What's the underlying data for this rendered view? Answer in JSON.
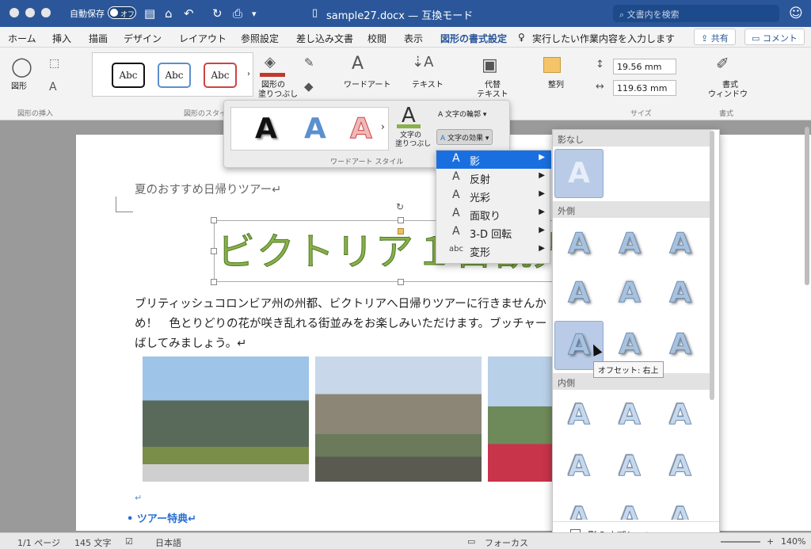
{
  "window": {
    "title": "sample27.docx — 互換モード",
    "autosave_label": "自動保存",
    "autosave_state": "オフ",
    "search_placeholder": "文書内を検索"
  },
  "tabs": [
    "ホーム",
    "挿入",
    "描画",
    "デザイン",
    "レイアウト",
    "参照設定",
    "差し込み文書",
    "校閲",
    "表示",
    "図形の書式設定"
  ],
  "tell_me": "実行したい作業内容を入力します",
  "share_label": "共有",
  "comment_label": "コメント",
  "ribbon": {
    "shapes_label": "図形",
    "group_insert": "図形の挿入",
    "group_styles": "図形のスタイ",
    "shape_style_samples": [
      "Abc",
      "Abc",
      "Abc"
    ],
    "fill_label": [
      "図形の",
      "塗りつぶし"
    ],
    "wordart_label": [
      "ワードアート",
      "スタイル"
    ],
    "text_label": "テキスト",
    "alt_text_label": [
      "代替",
      "テキスト"
    ],
    "arrange_label": "整列",
    "height_value": "19.56 mm",
    "width_value": "119.63 mm",
    "group_size": "サイズ",
    "format_pane_label": [
      "書式",
      "ウィンドウ"
    ],
    "group_format": "書式"
  },
  "wordart_panel": {
    "title": "ワードアート スタイル",
    "samples": [
      "A",
      "A",
      "A"
    ],
    "text_fill_label": [
      "文字の",
      "塗りつぶし"
    ],
    "text_outline_label": "文字の輪郭",
    "text_effects_label": "文字の効果"
  },
  "effects_menu": [
    {
      "label": "影",
      "icon": "A"
    },
    {
      "label": "反射",
      "icon": "A"
    },
    {
      "label": "光彩",
      "icon": "A"
    },
    {
      "label": "面取り",
      "icon": "A"
    },
    {
      "label": "3-D 回転",
      "icon": "A"
    },
    {
      "label": "変形",
      "icon": "abc"
    }
  ],
  "shadow_panel": {
    "no_shadow": "影なし",
    "outer": "外側",
    "inner": "内側",
    "sample_glyph": "A",
    "tooltip": "オフセット: 右上",
    "options_label": "影のオプション..."
  },
  "document": {
    "heading": "夏のおすすめ日帰りツアー↵",
    "wordart_text": "ビクトリア１日観光",
    "body_lines": [
      "ブリティッシュコロンビア州の州都、ビクトリアへ日帰りツアーに行きませんか",
      "め！　色とりどりの花が咲き乱れる街並みをお楽しみいただけます。ブッチャー",
      "ばしてみましょう。↵"
    ],
    "empty_para": "↵",
    "bullet": "ツアー特典↵"
  },
  "status": {
    "page": "1/1 ページ",
    "words": "145 文字",
    "language": "日本語",
    "focus": "フォーカス",
    "zoom": "140%"
  }
}
